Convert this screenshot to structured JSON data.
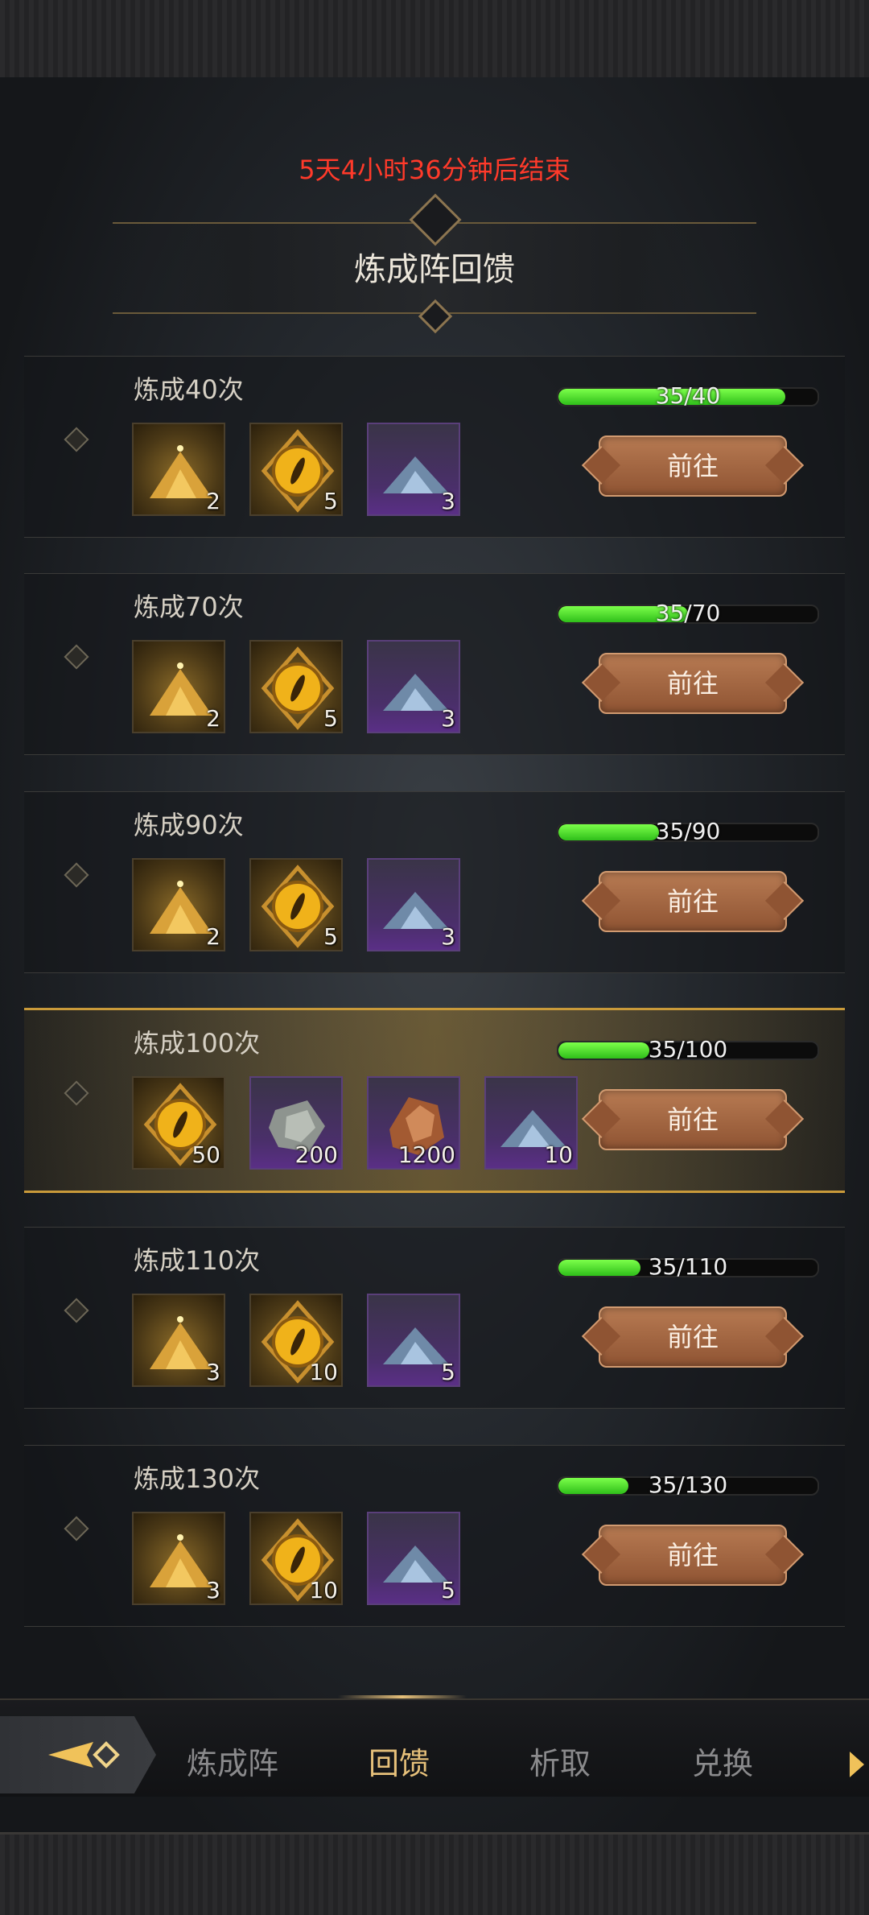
{
  "timer_text": "5天4小时36分钟后结束",
  "panel_title": "炼成阵回馈",
  "rewards": [
    {
      "title": "炼成40次",
      "progress_text": "35/40",
      "progress": 0.875,
      "button": "前往",
      "items": [
        {
          "type": "gold-dust",
          "count": "2"
        },
        {
          "type": "gold-eye",
          "count": "5"
        },
        {
          "type": "blue-crystal",
          "count": "3"
        }
      ]
    },
    {
      "title": "炼成70次",
      "progress_text": "35/70",
      "progress": 0.5,
      "button": "前往",
      "items": [
        {
          "type": "gold-dust",
          "count": "2"
        },
        {
          "type": "gold-eye",
          "count": "5"
        },
        {
          "type": "blue-crystal",
          "count": "3"
        }
      ]
    },
    {
      "title": "炼成90次",
      "progress_text": "35/90",
      "progress": 0.389,
      "button": "前往",
      "items": [
        {
          "type": "gold-dust",
          "count": "2"
        },
        {
          "type": "gold-eye",
          "count": "5"
        },
        {
          "type": "blue-crystal",
          "count": "3"
        }
      ]
    },
    {
      "title": "炼成100次",
      "progress_text": "35/100",
      "progress": 0.35,
      "button": "前往",
      "items": [
        {
          "type": "gold-eye",
          "count": "50"
        },
        {
          "type": "gray-ore",
          "count": "200"
        },
        {
          "type": "copper-ore",
          "count": "1200"
        },
        {
          "type": "blue-crystal",
          "count": "10"
        }
      ]
    },
    {
      "title": "炼成110次",
      "progress_text": "35/110",
      "progress": 0.318,
      "button": "前往",
      "items": [
        {
          "type": "gold-dust",
          "count": "3"
        },
        {
          "type": "gold-eye",
          "count": "10"
        },
        {
          "type": "blue-crystal",
          "count": "5"
        }
      ]
    },
    {
      "title": "炼成130次",
      "progress_text": "35/130",
      "progress": 0.269,
      "button": "前往",
      "items": [
        {
          "type": "gold-dust",
          "count": "3"
        },
        {
          "type": "gold-eye",
          "count": "10"
        },
        {
          "type": "blue-crystal",
          "count": "5"
        }
      ]
    }
  ],
  "tabs": [
    {
      "label": "炼成阵",
      "active": false
    },
    {
      "label": "回馈",
      "active": true
    },
    {
      "label": "析取",
      "active": false
    },
    {
      "label": "兑换",
      "active": false
    }
  ],
  "colors": {
    "timer": "#ff3a2a",
    "progress_fill": "#3fd424",
    "button": "#a4673f",
    "tab_active": "#e6c07a"
  }
}
